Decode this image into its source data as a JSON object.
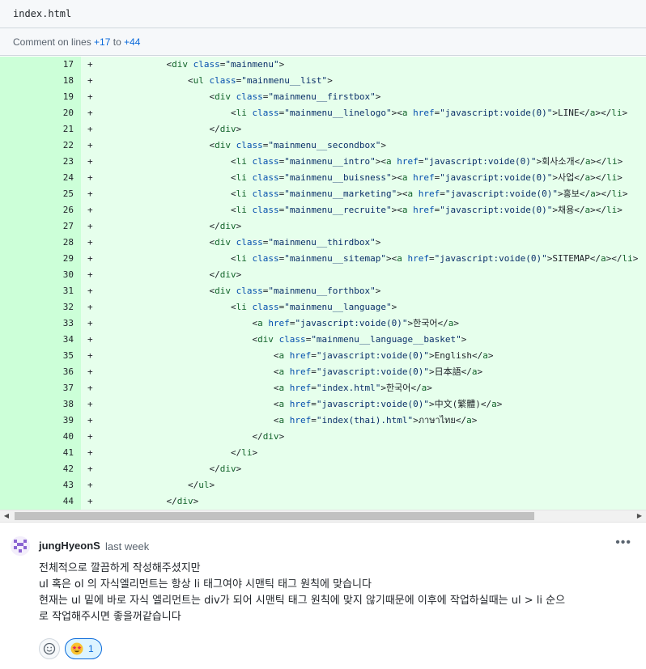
{
  "file": {
    "name": "index.html"
  },
  "comment_on": {
    "prefix": "Comment on lines ",
    "from": "+17",
    "to_word": " to ",
    "to": "+44"
  },
  "code": {
    "sign": "+",
    "lines": [
      {
        "n": "17",
        "tokens": [
          [
            "p",
            "            "
          ],
          [
            "p",
            "<"
          ],
          [
            "t",
            "div"
          ],
          [
            "p",
            " "
          ],
          [
            "a",
            "class"
          ],
          [
            "p",
            "="
          ],
          [
            "v",
            "\"mainmenu\""
          ],
          [
            "p",
            ">"
          ]
        ]
      },
      {
        "n": "18",
        "tokens": [
          [
            "p",
            "                "
          ],
          [
            "p",
            "<"
          ],
          [
            "t",
            "ul"
          ],
          [
            "p",
            " "
          ],
          [
            "a",
            "class"
          ],
          [
            "p",
            "="
          ],
          [
            "v",
            "\"mainmenu__list\""
          ],
          [
            "p",
            ">"
          ]
        ]
      },
      {
        "n": "19",
        "tokens": [
          [
            "p",
            "                    "
          ],
          [
            "p",
            "<"
          ],
          [
            "t",
            "div"
          ],
          [
            "p",
            " "
          ],
          [
            "a",
            "class"
          ],
          [
            "p",
            "="
          ],
          [
            "v",
            "\"mainmenu__firstbox\""
          ],
          [
            "p",
            ">"
          ]
        ]
      },
      {
        "n": "20",
        "tokens": [
          [
            "p",
            "                        "
          ],
          [
            "p",
            "<"
          ],
          [
            "t",
            "li"
          ],
          [
            "p",
            " "
          ],
          [
            "a",
            "class"
          ],
          [
            "p",
            "="
          ],
          [
            "v",
            "\"mainmenu__linelogo\""
          ],
          [
            "p",
            ">"
          ],
          [
            "p",
            "<"
          ],
          [
            "t",
            "a"
          ],
          [
            "p",
            " "
          ],
          [
            "a",
            "href"
          ],
          [
            "p",
            "="
          ],
          [
            "v",
            "\"javascript:voide(0)\""
          ],
          [
            "p",
            ">LINE</"
          ],
          [
            "t",
            "a"
          ],
          [
            "p",
            "></"
          ],
          [
            "t",
            "li"
          ],
          [
            "p",
            ">"
          ]
        ]
      },
      {
        "n": "21",
        "tokens": [
          [
            "p",
            "                    "
          ],
          [
            "p",
            "</"
          ],
          [
            "t",
            "div"
          ],
          [
            "p",
            ">"
          ]
        ]
      },
      {
        "n": "22",
        "tokens": [
          [
            "p",
            "                    "
          ],
          [
            "p",
            "<"
          ],
          [
            "t",
            "div"
          ],
          [
            "p",
            " "
          ],
          [
            "a",
            "class"
          ],
          [
            "p",
            "="
          ],
          [
            "v",
            "\"mainmenu__secondbox\""
          ],
          [
            "p",
            ">"
          ]
        ]
      },
      {
        "n": "23",
        "tokens": [
          [
            "p",
            "                        "
          ],
          [
            "p",
            "<"
          ],
          [
            "t",
            "li"
          ],
          [
            "p",
            " "
          ],
          [
            "a",
            "class"
          ],
          [
            "p",
            "="
          ],
          [
            "v",
            "\"mainmenu__intro\""
          ],
          [
            "p",
            ">"
          ],
          [
            "p",
            "<"
          ],
          [
            "t",
            "a"
          ],
          [
            "p",
            " "
          ],
          [
            "a",
            "href"
          ],
          [
            "p",
            "="
          ],
          [
            "v",
            "\"javascript:voide(0)\""
          ],
          [
            "p",
            ">회사소개</"
          ],
          [
            "t",
            "a"
          ],
          [
            "p",
            "></"
          ],
          [
            "t",
            "li"
          ],
          [
            "p",
            ">"
          ]
        ]
      },
      {
        "n": "24",
        "tokens": [
          [
            "p",
            "                        "
          ],
          [
            "p",
            "<"
          ],
          [
            "t",
            "li"
          ],
          [
            "p",
            " "
          ],
          [
            "a",
            "class"
          ],
          [
            "p",
            "="
          ],
          [
            "v",
            "\"mainmenu__buisness\""
          ],
          [
            "p",
            ">"
          ],
          [
            "p",
            "<"
          ],
          [
            "t",
            "a"
          ],
          [
            "p",
            " "
          ],
          [
            "a",
            "href"
          ],
          [
            "p",
            "="
          ],
          [
            "v",
            "\"javascript:voide(0)\""
          ],
          [
            "p",
            ">사업</"
          ],
          [
            "t",
            "a"
          ],
          [
            "p",
            "></"
          ],
          [
            "t",
            "li"
          ],
          [
            "p",
            ">"
          ]
        ]
      },
      {
        "n": "25",
        "tokens": [
          [
            "p",
            "                        "
          ],
          [
            "p",
            "<"
          ],
          [
            "t",
            "li"
          ],
          [
            "p",
            " "
          ],
          [
            "a",
            "class"
          ],
          [
            "p",
            "="
          ],
          [
            "v",
            "\"mainmenu__marketing\""
          ],
          [
            "p",
            ">"
          ],
          [
            "p",
            "<"
          ],
          [
            "t",
            "a"
          ],
          [
            "p",
            " "
          ],
          [
            "a",
            "href"
          ],
          [
            "p",
            "="
          ],
          [
            "v",
            "\"javascript:voide(0)\""
          ],
          [
            "p",
            ">홍보</"
          ],
          [
            "t",
            "a"
          ],
          [
            "p",
            "></"
          ],
          [
            "t",
            "li"
          ],
          [
            "p",
            ">"
          ]
        ]
      },
      {
        "n": "26",
        "tokens": [
          [
            "p",
            "                        "
          ],
          [
            "p",
            "<"
          ],
          [
            "t",
            "li"
          ],
          [
            "p",
            " "
          ],
          [
            "a",
            "class"
          ],
          [
            "p",
            "="
          ],
          [
            "v",
            "\"mainmenu__recruite\""
          ],
          [
            "p",
            ">"
          ],
          [
            "p",
            "<"
          ],
          [
            "t",
            "a"
          ],
          [
            "p",
            " "
          ],
          [
            "a",
            "href"
          ],
          [
            "p",
            "="
          ],
          [
            "v",
            "\"javascript:voide(0)\""
          ],
          [
            "p",
            ">채용</"
          ],
          [
            "t",
            "a"
          ],
          [
            "p",
            "></"
          ],
          [
            "t",
            "li"
          ],
          [
            "p",
            ">"
          ]
        ]
      },
      {
        "n": "27",
        "tokens": [
          [
            "p",
            "                    "
          ],
          [
            "p",
            "</"
          ],
          [
            "t",
            "div"
          ],
          [
            "p",
            ">"
          ]
        ]
      },
      {
        "n": "28",
        "tokens": [
          [
            "p",
            "                    "
          ],
          [
            "p",
            "<"
          ],
          [
            "t",
            "div"
          ],
          [
            "p",
            " "
          ],
          [
            "a",
            "class"
          ],
          [
            "p",
            "="
          ],
          [
            "v",
            "\"mainmenu__thirdbox\""
          ],
          [
            "p",
            ">"
          ]
        ]
      },
      {
        "n": "29",
        "tokens": [
          [
            "p",
            "                        "
          ],
          [
            "p",
            "<"
          ],
          [
            "t",
            "li"
          ],
          [
            "p",
            " "
          ],
          [
            "a",
            "class"
          ],
          [
            "p",
            "="
          ],
          [
            "v",
            "\"mainmenu__sitemap\""
          ],
          [
            "p",
            ">"
          ],
          [
            "p",
            "<"
          ],
          [
            "t",
            "a"
          ],
          [
            "p",
            " "
          ],
          [
            "a",
            "href"
          ],
          [
            "p",
            "="
          ],
          [
            "v",
            "\"javascript:voide(0)\""
          ],
          [
            "p",
            ">SITEMAP</"
          ],
          [
            "t",
            "a"
          ],
          [
            "p",
            "></"
          ],
          [
            "t",
            "li"
          ],
          [
            "p",
            ">"
          ]
        ]
      },
      {
        "n": "30",
        "tokens": [
          [
            "p",
            "                    "
          ],
          [
            "p",
            "</"
          ],
          [
            "t",
            "div"
          ],
          [
            "p",
            ">"
          ]
        ]
      },
      {
        "n": "31",
        "tokens": [
          [
            "p",
            "                    "
          ],
          [
            "p",
            "<"
          ],
          [
            "t",
            "div"
          ],
          [
            "p",
            " "
          ],
          [
            "a",
            "class"
          ],
          [
            "p",
            "="
          ],
          [
            "v",
            "\"mainmenu__forthbox\""
          ],
          [
            "p",
            ">"
          ]
        ]
      },
      {
        "n": "32",
        "tokens": [
          [
            "p",
            "                        "
          ],
          [
            "p",
            "<"
          ],
          [
            "t",
            "li"
          ],
          [
            "p",
            " "
          ],
          [
            "a",
            "class"
          ],
          [
            "p",
            "="
          ],
          [
            "v",
            "\"mainmenu__language\""
          ],
          [
            "p",
            ">"
          ]
        ]
      },
      {
        "n": "33",
        "tokens": [
          [
            "p",
            "                            "
          ],
          [
            "p",
            "<"
          ],
          [
            "t",
            "a"
          ],
          [
            "p",
            " "
          ],
          [
            "a",
            "href"
          ],
          [
            "p",
            "="
          ],
          [
            "v",
            "\"javascript:voide(0)\""
          ],
          [
            "p",
            ">한국어</"
          ],
          [
            "t",
            "a"
          ],
          [
            "p",
            ">"
          ]
        ]
      },
      {
        "n": "34",
        "tokens": [
          [
            "p",
            "                            "
          ],
          [
            "p",
            "<"
          ],
          [
            "t",
            "div"
          ],
          [
            "p",
            " "
          ],
          [
            "a",
            "class"
          ],
          [
            "p",
            "="
          ],
          [
            "v",
            "\"mainmenu__language__basket\""
          ],
          [
            "p",
            ">"
          ]
        ]
      },
      {
        "n": "35",
        "tokens": [
          [
            "p",
            "                                "
          ],
          [
            "p",
            "<"
          ],
          [
            "t",
            "a"
          ],
          [
            "p",
            " "
          ],
          [
            "a",
            "href"
          ],
          [
            "p",
            "="
          ],
          [
            "v",
            "\"javascript:voide(0)\""
          ],
          [
            "p",
            ">English</"
          ],
          [
            "t",
            "a"
          ],
          [
            "p",
            ">"
          ]
        ]
      },
      {
        "n": "36",
        "tokens": [
          [
            "p",
            "                                "
          ],
          [
            "p",
            "<"
          ],
          [
            "t",
            "a"
          ],
          [
            "p",
            " "
          ],
          [
            "a",
            "href"
          ],
          [
            "p",
            "="
          ],
          [
            "v",
            "\"javascript:voide(0)\""
          ],
          [
            "p",
            ">日本語</"
          ],
          [
            "t",
            "a"
          ],
          [
            "p",
            ">"
          ]
        ]
      },
      {
        "n": "37",
        "tokens": [
          [
            "p",
            "                                "
          ],
          [
            "p",
            "<"
          ],
          [
            "t",
            "a"
          ],
          [
            "p",
            " "
          ],
          [
            "a",
            "href"
          ],
          [
            "p",
            "="
          ],
          [
            "v",
            "\"index.html\""
          ],
          [
            "p",
            ">한국어</"
          ],
          [
            "t",
            "a"
          ],
          [
            "p",
            ">"
          ]
        ]
      },
      {
        "n": "38",
        "tokens": [
          [
            "p",
            "                                "
          ],
          [
            "p",
            "<"
          ],
          [
            "t",
            "a"
          ],
          [
            "p",
            " "
          ],
          [
            "a",
            "href"
          ],
          [
            "p",
            "="
          ],
          [
            "v",
            "\"javascript:voide(0)\""
          ],
          [
            "p",
            ">中文(繁體)</"
          ],
          [
            "t",
            "a"
          ],
          [
            "p",
            ">"
          ]
        ]
      },
      {
        "n": "39",
        "tokens": [
          [
            "p",
            "                                "
          ],
          [
            "p",
            "<"
          ],
          [
            "t",
            "a"
          ],
          [
            "p",
            " "
          ],
          [
            "a",
            "href"
          ],
          [
            "p",
            "="
          ],
          [
            "v",
            "\"index(thai).html\""
          ],
          [
            "p",
            ">ภาษาไทย</"
          ],
          [
            "t",
            "a"
          ],
          [
            "p",
            ">"
          ]
        ]
      },
      {
        "n": "40",
        "tokens": [
          [
            "p",
            "                            "
          ],
          [
            "p",
            "</"
          ],
          [
            "t",
            "div"
          ],
          [
            "p",
            ">"
          ]
        ]
      },
      {
        "n": "41",
        "tokens": [
          [
            "p",
            "                        "
          ],
          [
            "p",
            "</"
          ],
          [
            "t",
            "li"
          ],
          [
            "p",
            ">"
          ]
        ]
      },
      {
        "n": "42",
        "tokens": [
          [
            "p",
            "                    "
          ],
          [
            "p",
            "</"
          ],
          [
            "t",
            "div"
          ],
          [
            "p",
            ">"
          ]
        ]
      },
      {
        "n": "43",
        "tokens": [
          [
            "p",
            "                "
          ],
          [
            "p",
            "</"
          ],
          [
            "t",
            "ul"
          ],
          [
            "p",
            ">"
          ]
        ]
      },
      {
        "n": "44",
        "tokens": [
          [
            "p",
            "            "
          ],
          [
            "p",
            "</"
          ],
          [
            "t",
            "div"
          ],
          [
            "p",
            ">"
          ]
        ]
      }
    ]
  },
  "comment": {
    "author": "jungHyeonS",
    "time": "last week",
    "more_icon": "kebab-horizontal-icon",
    "body_lines": [
      "전체적으로 깔끔하게 작성해주셨지만",
      "ul 혹은 ol 의 자식엘리먼트는 항상 li 태그여야 시맨틱 태그 원칙에 맞습니다",
      "현재는 ul 밑에 바로 자식 엘리먼트는 div가 되어 시맨틱 태그 원칙에 맞지 않기때문에 이후에 작업하실때는 ul > li 순으",
      "로 작업해주시면 좋을꺼같습니다"
    ],
    "reactions": [
      {
        "emoji": "grinning-face-with-star-eyes",
        "count": "1"
      }
    ]
  },
  "colors": {
    "added_line_bg": "#e6ffec",
    "added_num_bg": "#ccffd8",
    "link": "#0969da",
    "tag": "#116329",
    "attr": "#0550ae",
    "string": "#0a3069"
  }
}
